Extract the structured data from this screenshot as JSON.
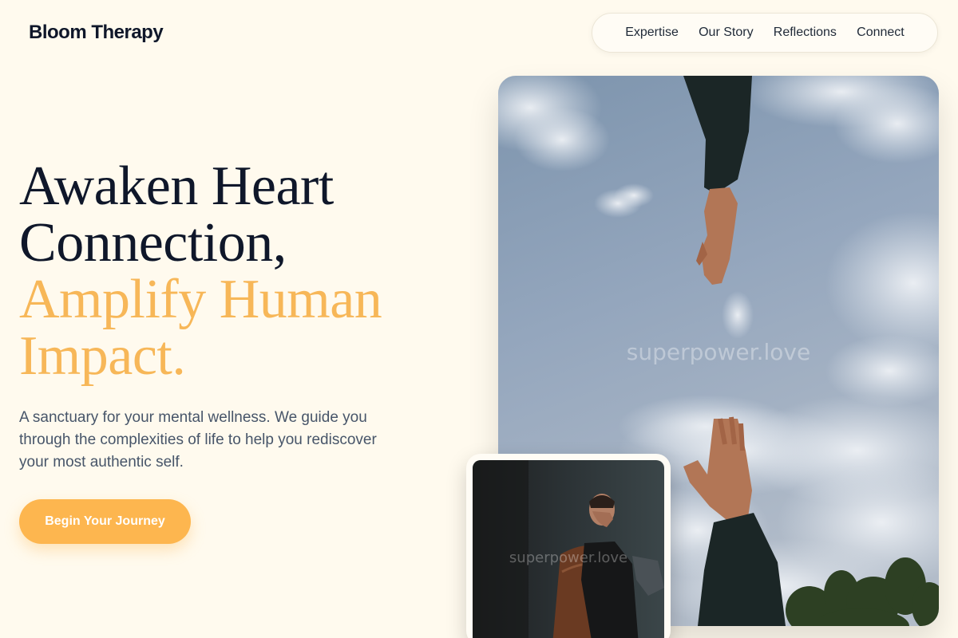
{
  "brand": {
    "name": "Bloom Therapy"
  },
  "nav": {
    "items": [
      "Expertise",
      "Our Story",
      "Reflections",
      "Connect"
    ]
  },
  "hero": {
    "headline_line1": "Awaken Heart Connection,",
    "headline_line2": "Amplify Human Impact.",
    "description": "A sanctuary for your mental wellness. We guide you through the complexities of life to help you rediscover your most authentic self.",
    "cta_label": "Begin Your Journey"
  },
  "images": {
    "main_watermark": "superpower.love",
    "thumb_watermark": "superpower.love"
  },
  "colors": {
    "background": "#fffaee",
    "accent": "#f7b758",
    "button": "#fdb64f",
    "headline": "#0f172a",
    "body_text": "#475569"
  }
}
